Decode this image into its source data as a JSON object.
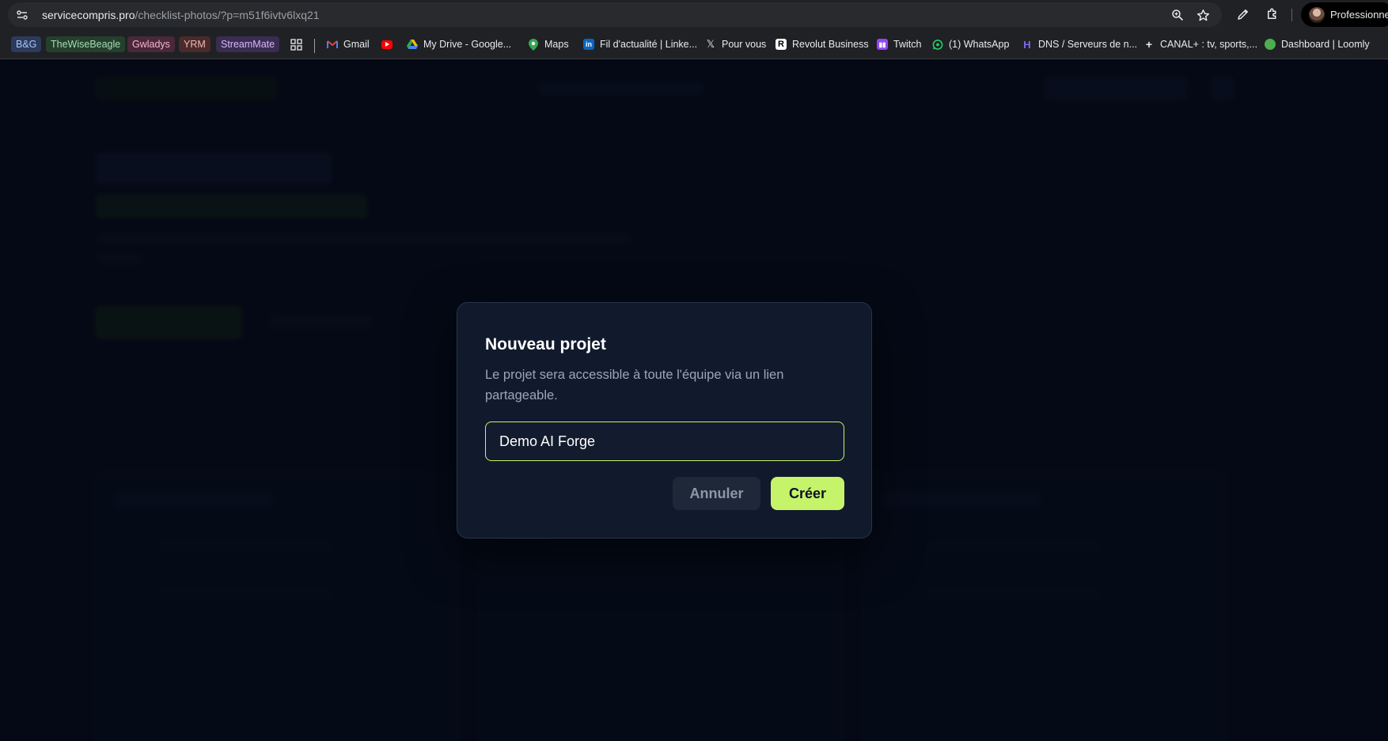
{
  "browser": {
    "url_host": "servicecompris.pro",
    "url_path": "/checklist-photos/?p=m51f6ivtv6lxq21",
    "profile_label": "Professionnel"
  },
  "bookmarks": {
    "chips": [
      "B&G",
      "TheWiseBeagle",
      "Gwladys",
      "YRM",
      "StreamMate"
    ],
    "items": [
      "Gmail",
      "My Drive - Google...",
      "Maps",
      "Fil d'actualité | Linke...",
      "Pour vous",
      "Revolut Business",
      "Twitch",
      "(1) WhatsApp",
      "DNS / Serveurs de n...",
      "CANAL+ : tv, sports,...",
      "Dashboard | Loomly"
    ]
  },
  "modal": {
    "title": "Nouveau projet",
    "description": "Le projet sera accessible à toute l'équipe via un lien partageable.",
    "input_value": "Demo AI Forge",
    "cancel_label": "Annuler",
    "create_label": "Créer"
  },
  "colors": {
    "accent": "#c5f36a",
    "modal_bg": "#111a2c",
    "page_bg": "#0b1224"
  },
  "icons": [
    "site-info-icon",
    "zoom-icon",
    "bookmark-star-icon",
    "pen-icon",
    "extensions-icon",
    "apps-grid-icon",
    "gmail-icon",
    "youtube-icon",
    "drive-icon",
    "maps-icon",
    "linkedin-icon",
    "x-icon",
    "revolut-icon",
    "twitch-icon",
    "whatsapp-icon",
    "dns-icon",
    "canal-icon",
    "loomly-icon"
  ]
}
